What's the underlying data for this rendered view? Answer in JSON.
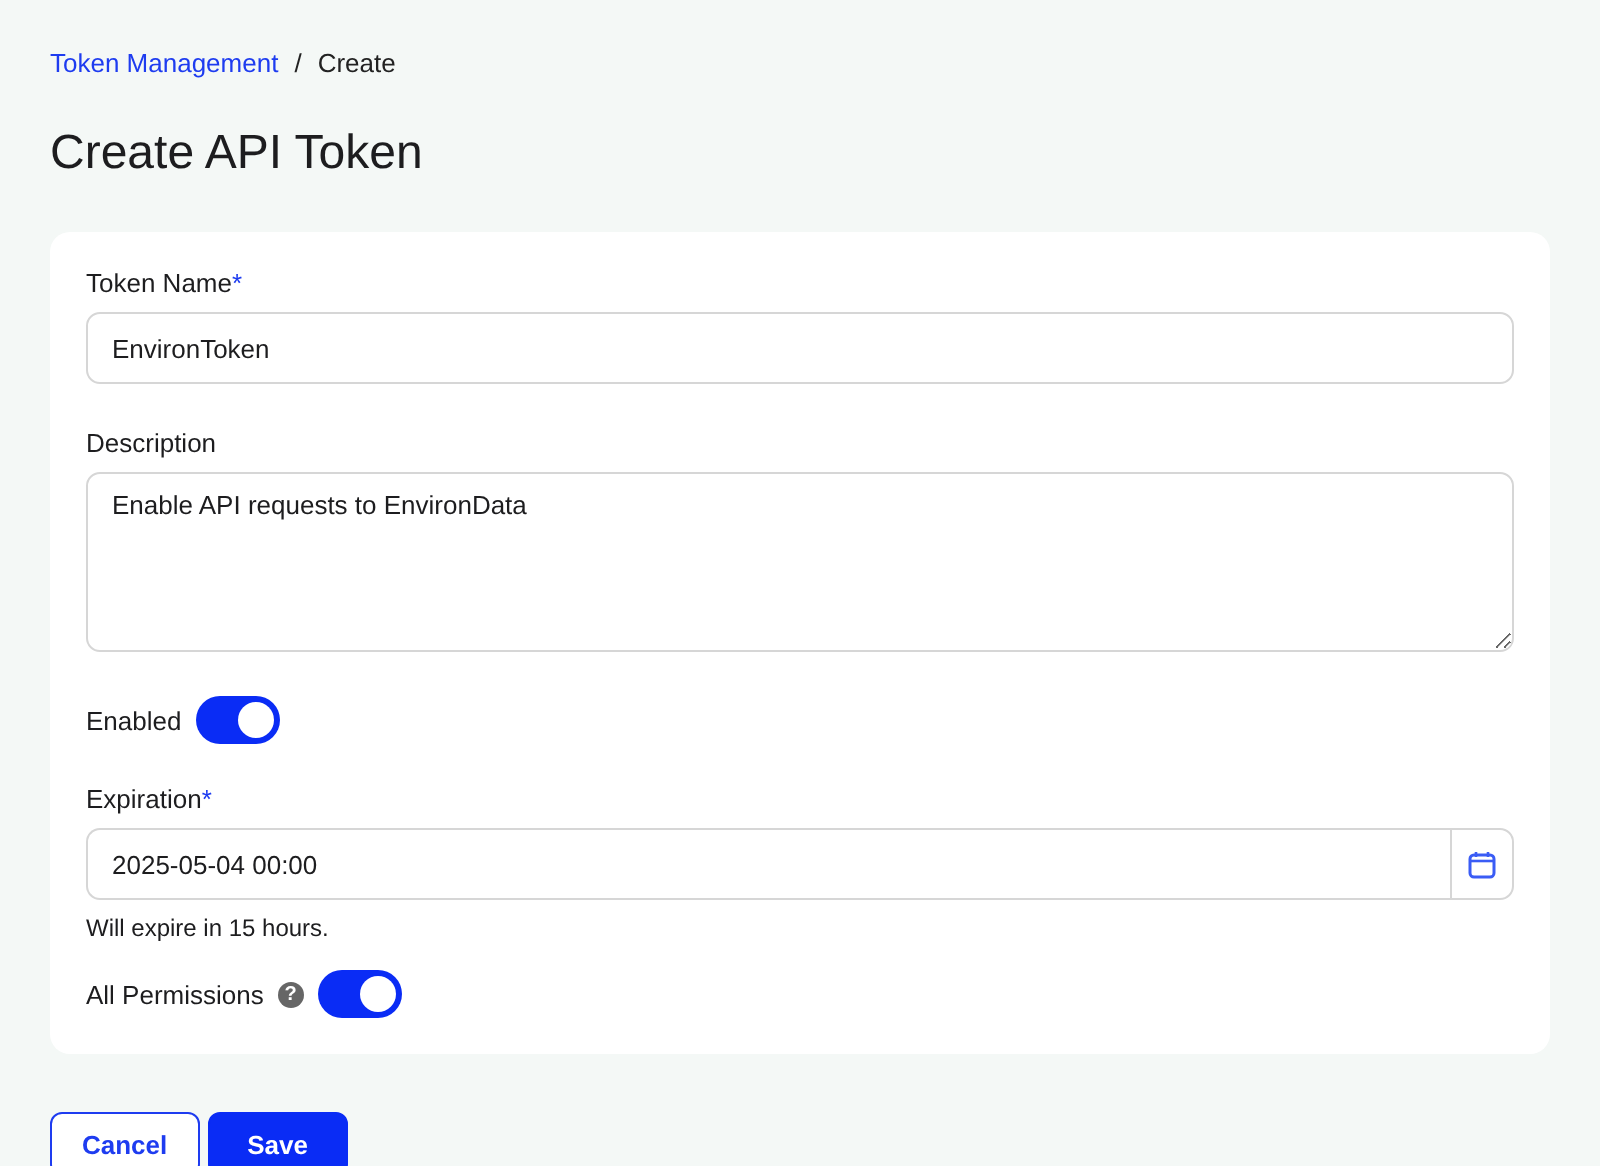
{
  "breadcrumb": [
    {
      "label": "Token Management",
      "kind": "link"
    },
    {
      "label": "Create",
      "kind": "current"
    }
  ],
  "separator": "/",
  "title": "Create API Token",
  "fields": [
    {
      "kind": "text",
      "label": "Token Name",
      "required_mark": "*",
      "value": "EnvironToken"
    },
    {
      "kind": "textarea",
      "label": "Description",
      "value": "Enable API requests to EnvironData"
    },
    {
      "kind": "toggle",
      "label": "Enabled",
      "on": true
    },
    {
      "kind": "date",
      "label": "Expiration",
      "required_mark": "*",
      "value": "2025-05-04 00:00",
      "hint": "Will expire in 15 hours."
    },
    {
      "kind": "toggle",
      "label": "All Permissions",
      "on": true,
      "help": "?"
    }
  ],
  "buttons": [
    {
      "label": "Cancel",
      "kind": "secondary"
    },
    {
      "label": "Save",
      "kind": "primary"
    }
  ]
}
